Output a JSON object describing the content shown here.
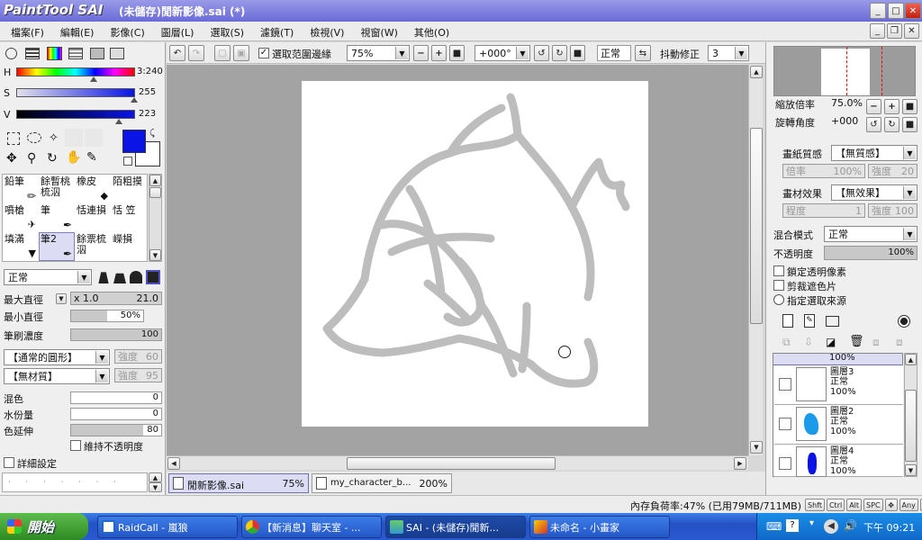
{
  "app": {
    "logo": "PaintTool SAI",
    "title": "(未儲存)閒新影像.sai (*)"
  },
  "menu": [
    "檔案(F)",
    "編輯(E)",
    "影像(C)",
    "圖層(L)",
    "選取(S)",
    "濾鏡(T)",
    "檢視(V)",
    "視窗(W)",
    "其他(O)"
  ],
  "color": {
    "h_label": "H",
    "h_value": "3:240",
    "s_label": "S",
    "s_value": "255",
    "v_label": "V",
    "v_value": "223",
    "primary": "#0a14e6"
  },
  "tools": [
    {
      "label": "鉛筆"
    },
    {
      "label": "餘暫桃梳泅"
    },
    {
      "label": "橡皮"
    },
    {
      "label": "陌粗摸"
    },
    {
      "label": "噴槍"
    },
    {
      "label": "筆"
    },
    {
      "label": "恬連損"
    },
    {
      "label": "恬 笠"
    },
    {
      "label": "填滿"
    },
    {
      "label": "筆2"
    },
    {
      "label": "餘票梳泅"
    },
    {
      "label": "嶸損"
    }
  ],
  "brush": {
    "mode": "正常",
    "max_size_label": "最大直徑",
    "max_size_mult": "x 1.0",
    "max_size_value": "21.0",
    "min_size_label": "最小直徑",
    "min_size_value": "50%",
    "min_size_pct": 50,
    "density_label": "筆刷濃度",
    "density_value": "100",
    "density_pct": 100,
    "shape": "【通常的圓形】",
    "shape_strength_label": "強度",
    "shape_strength": "60",
    "texture": "【無材質】",
    "texture_strength_label": "強度",
    "texture_strength": "95",
    "blend_label": "混色",
    "blend_value": "0",
    "water_label": "水份量",
    "water_value": "0",
    "persist_label": "色延伸",
    "persist_value": "80",
    "persist_pct": 80,
    "keep_opacity_label": "維持不透明度",
    "detail_label": "詳細設定"
  },
  "toolbar": {
    "selection_edge": "選取范圍邊緣",
    "zoom": "75%",
    "angle": "+000°",
    "mode": "正常",
    "stab_label": "抖動修正",
    "stab_value": "3"
  },
  "navigator": {
    "zoom_label": "縮放倍率",
    "zoom_value": "75.0%",
    "rotate_label": "旋轉角度",
    "rotate_value": "+000"
  },
  "paper": {
    "texture_label": "畫紙質感",
    "texture_value": "【無質感】",
    "scale_label": "倍率",
    "scale_value": "100%",
    "strength_label": "強度",
    "strength_value": "20",
    "effect_label": "畫材效果",
    "effect_value": "【無效果】",
    "degree_label": "程度",
    "degree_value": "1",
    "strength2_label": "強度",
    "strength2_value": "100"
  },
  "layer_props": {
    "blend_label": "混合模式",
    "blend_value": "正常",
    "opacity_label": "不透明度",
    "opacity_value": "100%",
    "lock_label": "鎖定透明像素",
    "clip_label": "剪裁遮色片",
    "source_label": "指定選取來源"
  },
  "layers": [
    {
      "name": "",
      "mode": "",
      "opacity": "100%"
    },
    {
      "name": "圖層3",
      "mode": "正常",
      "opacity": "100%"
    },
    {
      "name": "圖層2",
      "mode": "正常",
      "opacity": "100%"
    },
    {
      "name": "圖層4",
      "mode": "正常",
      "opacity": "100%"
    }
  ],
  "tabs": [
    {
      "name": "閒新影像.sai",
      "zoom": "75%"
    },
    {
      "name": "my_character_b...",
      "zoom": "200%"
    }
  ],
  "status": {
    "memory": "內存負荷率:47% (已用79MB/711MB)",
    "keys": [
      "Shft",
      "Ctrl",
      "Alt",
      "SPC",
      "Any"
    ]
  },
  "taskbar": {
    "start": "開始",
    "items": [
      "RaidCall - 嵐狼",
      "【新消息】聊天室 - ...",
      "SAI - (未儲存)閒新...",
      "未命名 - 小畫家"
    ],
    "clock": "下午 09:21"
  }
}
